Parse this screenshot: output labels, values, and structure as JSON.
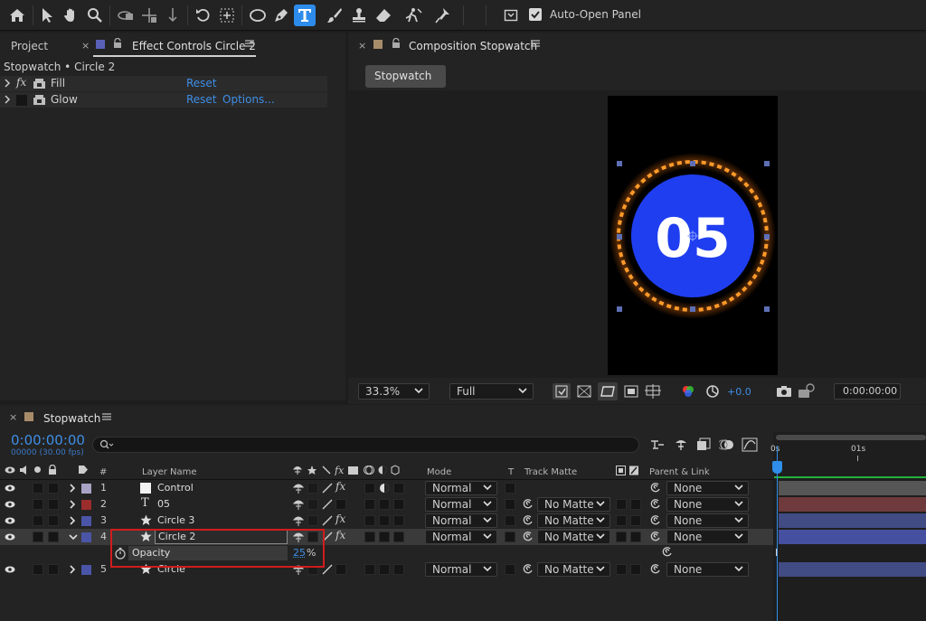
{
  "toolbar": {
    "tools": [
      "home-icon",
      "selection-icon",
      "hand-icon",
      "zoom-icon",
      "orbit-icon",
      "pan-icon",
      "dolly-icon",
      "rotate-icon",
      "pan-behind-icon",
      "ellipse-icon",
      "pen-icon",
      "type-icon",
      "brush-icon",
      "clone-stamp-icon",
      "eraser-icon",
      "roto-brush-icon",
      "puppet-icon"
    ],
    "active_tool": "type-icon",
    "auto_open_label": "Auto-Open Panel",
    "auto_open_checked": true
  },
  "left_panel": {
    "tabs": [
      {
        "label": "Project"
      },
      {
        "label": "Effect Controls Circle 2"
      }
    ],
    "breadcrumb": "Stopwatch • Circle 2",
    "effects": [
      {
        "name": "Fill",
        "reset": "Reset",
        "options": ""
      },
      {
        "name": "Glow",
        "reset": "Reset",
        "options": "Options..."
      }
    ]
  },
  "comp_panel": {
    "tab_label": "Composition Stopwatch",
    "breadcrumb_button": "Stopwatch",
    "canvas_number": "05",
    "zoom": "33.3%",
    "resolution": "Full",
    "exposure": "+0.0",
    "timecode": "0:00:00:00",
    "colors": {
      "circle": "#1f3ef0",
      "ring": "#ff9a2a",
      "canvas": "#000000"
    }
  },
  "timeline": {
    "tab_label": "Stopwatch",
    "timecode": "0:00:00:00",
    "fps": "00000 (30.00 fps)",
    "search_placeholder": "",
    "headers": {
      "num": "#",
      "layer_name": "Layer Name",
      "mode": "Mode",
      "t": "T",
      "track_matte": "Track Matte",
      "parent": "Parent & Link"
    },
    "ruler": [
      "0s",
      "01s"
    ],
    "layers": [
      {
        "num": "1",
        "type": "solid",
        "name": "Control",
        "color": "#a9a3c6",
        "mode": "Normal",
        "matte": "",
        "parent": "None",
        "fx": true,
        "bar": "#565656"
      },
      {
        "num": "2",
        "type": "text",
        "name": "05",
        "color": "#9b2d2d",
        "mode": "Normal",
        "matte": "No Matte",
        "parent": "None",
        "fx": false,
        "bar": "#6e3a3b"
      },
      {
        "num": "3",
        "type": "shape",
        "name": "Circle 3",
        "color": "#4b55a8",
        "mode": "Normal",
        "matte": "No Matte",
        "parent": "None",
        "fx": true,
        "bar": "#414b84"
      },
      {
        "num": "4",
        "type": "shape",
        "name": "Circle 2",
        "color": "#4b55a8",
        "mode": "Normal",
        "matte": "No Matte",
        "parent": "None",
        "fx": true,
        "bar": "#4650a0",
        "selected": true
      },
      {
        "num": "5",
        "type": "shape",
        "name": "Circle",
        "color": "#4b55a8",
        "mode": "Normal",
        "matte": "No Matte",
        "parent": "None",
        "fx": false,
        "bar": "#414b84"
      }
    ],
    "property": {
      "name": "Opacity",
      "value": "25",
      "unit": "%"
    }
  }
}
